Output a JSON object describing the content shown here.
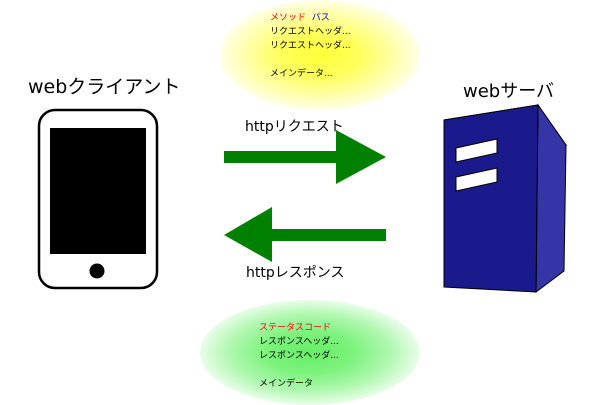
{
  "client": {
    "label": "webクライアント"
  },
  "server": {
    "label": "webサーバ"
  },
  "request": {
    "label": "httpリクエスト",
    "arrow_color": "#008000",
    "glow_color": "#ffff00",
    "method": "メソッド",
    "path": "パス",
    "header_line_1": "リクエストヘッダ...",
    "header_line_2": "リクエストヘッダ...",
    "body": "メインデータ..."
  },
  "response": {
    "label": "httpレスポンス",
    "arrow_color": "#008000",
    "glow_color": "#66ee66",
    "status_code": "ステータスコード",
    "header_line_1": "レスポンスヘッダ...",
    "header_line_2": "レスポンスヘッダ...",
    "body": "メインデータ"
  },
  "colors": {
    "highlight_red": "#ff0000",
    "highlight_blue": "#0000cc",
    "server_blue": "#1a1a8c"
  }
}
